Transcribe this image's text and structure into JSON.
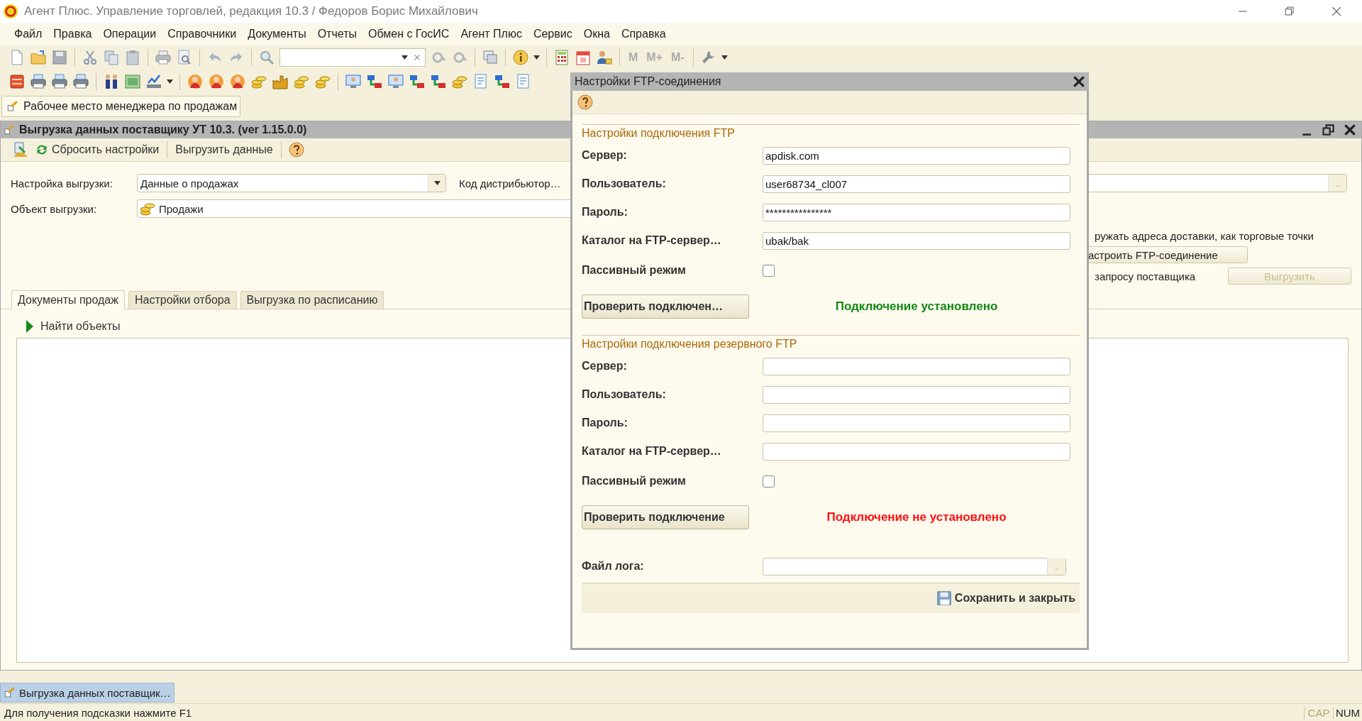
{
  "window": {
    "title": "Агент Плюс. Управление торговлей, редакция 10.3 / Федоров Борис Михайлович"
  },
  "menu": [
    "Файл",
    "Правка",
    "Операции",
    "Справочники",
    "Документы",
    "Отчеты",
    "Обмен с ГосИС",
    "Агент Плюс",
    "Сервис",
    "Окна",
    "Справка"
  ],
  "memory_buttons": [
    {
      "label": "M",
      "disabled": true
    },
    {
      "label": "M+",
      "disabled": true
    },
    {
      "label": "M-",
      "disabled": true
    }
  ],
  "workspace_tab": {
    "label": "Рабочее место менеджера по продажам"
  },
  "form_window": {
    "title": "Выгрузка данных поставщику УТ 10.3. (ver 1.15.0.0)",
    "toolbar": [
      "Сбросить настройки",
      "Выгрузить данные"
    ],
    "setting": {
      "label": "Настройка выгрузки:",
      "value": "Данные о продажах"
    },
    "distributor": {
      "label": "Код дистрибьютор…"
    },
    "object": {
      "label": "Объект выгрузки:",
      "value": "Продажи"
    },
    "delivery_text": "ружать адреса доставки, как торговые точки",
    "ftp_button": "астроить FTP-соединение",
    "request_text": "запросу поставщика",
    "export_button": {
      "label": "Выгрузить",
      "disabled": true
    },
    "tabs": [
      {
        "label": "Документы продаж",
        "selected": true
      },
      {
        "label": "Настройки отбора",
        "selected": false
      },
      {
        "label": "Выгрузка по расписанию",
        "selected": false
      }
    ],
    "find_objects": {
      "label": "Найти объекты",
      "expanded": false
    }
  },
  "dialog": {
    "title": "Настройки FTP-соединения",
    "sections": [
      {
        "title": "Настройки подключения FTP",
        "fields": [
          {
            "label": "Сервер:",
            "value": "apdisk.com"
          },
          {
            "label": "Пользователь:",
            "value": "user68734_cl007"
          },
          {
            "label": "Пароль:",
            "value": "****************"
          },
          {
            "label": "Каталог на FTP-сервер…",
            "value": "ubak/bak"
          }
        ],
        "passive": {
          "label": "Пассивный режим",
          "checked": false
        },
        "button": "Проверить подключен…",
        "status": {
          "text": "Подключение установлено",
          "ok": true
        }
      },
      {
        "title": "Настройки подключения резервного FTP",
        "fields": [
          {
            "label": "Сервер:"
          },
          {
            "label": "Пользователь:"
          },
          {
            "label": "Пароль:"
          },
          {
            "label": "Каталог на FTP-сервер…"
          }
        ],
        "passive": {
          "label": "Пассивный режим",
          "checked": false
        },
        "button": "Проверить подключение",
        "status": {
          "text": "Подключение не установлено",
          "ok": false
        }
      }
    ],
    "log": {
      "label": "Файл лога:"
    },
    "save_button": "Сохранить и закрыть"
  },
  "taskbar": [
    {
      "label": "Выгрузка данных поставщик…",
      "selected": true
    }
  ],
  "status_bar": {
    "hint": "Для получения подсказки нажмите F1",
    "indicators": [
      {
        "label": "CAP",
        "on": false
      },
      {
        "label": "NUM",
        "on": true
      }
    ]
  }
}
